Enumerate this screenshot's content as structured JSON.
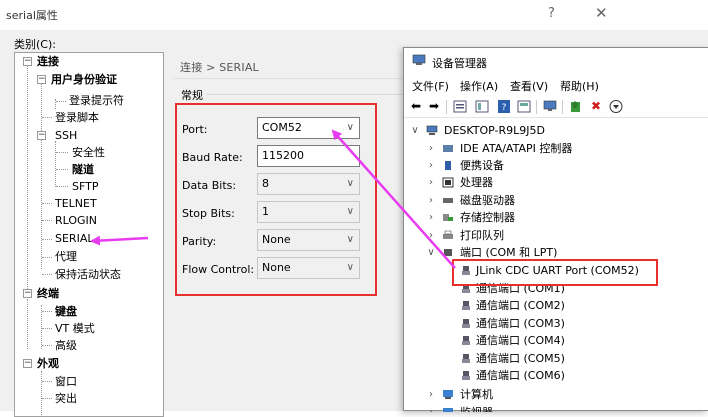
{
  "dialog": {
    "title": "serial属性",
    "help": "?",
    "close": "✕",
    "category_label": "类别(C):",
    "breadcrumb": "连接 > SERIAL",
    "group_title": "常规"
  },
  "category_tree": {
    "connection": "连接",
    "auth": "用户身份验证",
    "login_prompt": "登录提示符",
    "login_script": "登录脚本",
    "ssh": "SSH",
    "security": "安全性",
    "tunnel": "隧道",
    "sftp": "SFTP",
    "telnet": "TELNET",
    "rlogin": "RLOGIN",
    "serial": "SERIAL",
    "proxy": "代理",
    "keepalive": "保持活动状态",
    "terminal": "终端",
    "keyboard": "键盘",
    "vt_mode": "VT 模式",
    "advanced": "高级",
    "appearance": "外观",
    "window": "窗口",
    "highlight": "突出"
  },
  "form": {
    "port_label": "Port:",
    "port_value": "COM52",
    "baud_label": "Baud Rate:",
    "baud_value": "115200",
    "databits_label": "Data Bits:",
    "databits_value": "8",
    "stopbits_label": "Stop Bits:",
    "stopbits_value": "1",
    "parity_label": "Parity:",
    "parity_value": "None",
    "flow_label": "Flow Control:",
    "flow_value": "None",
    "chevron": "∨"
  },
  "device_manager": {
    "title": "设备管理器",
    "menu": [
      "文件(F)",
      "操作(A)",
      "查看(V)",
      "帮助(H)"
    ],
    "computer": "DESKTOP-R9L9J5D",
    "categories": {
      "ide": "IDE ATA/ATAPI 控制器",
      "portable": "便携设备",
      "processor": "处理器",
      "disk": "磁盘驱动器",
      "storage": "存储控制器",
      "print_queue": "打印队列",
      "ports": "端口 (COM 和 LPT)",
      "computer": "计算机",
      "monitor": "监视器"
    },
    "ports": [
      "JLink CDC UART Port (COM52)",
      "通信端口 (COM1)",
      "通信端口 (COM2)",
      "通信端口 (COM3)",
      "通信端口 (COM4)",
      "通信端口 (COM5)",
      "通信端口 (COM6)"
    ]
  },
  "colors": {
    "annotation_red": "#e8312c",
    "arrow_magenta": "#e83cf0",
    "selection_blue": "#cce8ff"
  }
}
